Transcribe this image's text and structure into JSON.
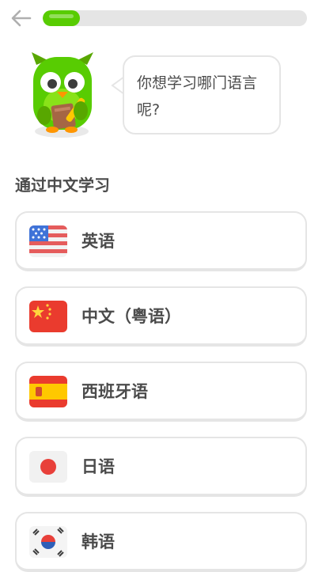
{
  "progress": {
    "fraction": 0.14
  },
  "header": {
    "back_icon": "arrow-left-icon"
  },
  "mascot": {
    "icon": "owl-mascot-icon"
  },
  "speech": {
    "text": "你想学习哪门语言呢?"
  },
  "section": {
    "title": "通过中文学习"
  },
  "languages": [
    {
      "label": "英语",
      "flag": "us-flag-icon"
    },
    {
      "label": "中文（粤语）",
      "flag": "china-flag-icon"
    },
    {
      "label": "西班牙语",
      "flag": "spain-flag-icon"
    },
    {
      "label": "日语",
      "flag": "japan-flag-icon"
    },
    {
      "label": "韩语",
      "flag": "korea-flag-icon"
    }
  ],
  "colors": {
    "accent": "#58cc02",
    "border": "#e5e5e5",
    "text": "#4b4b4b"
  }
}
